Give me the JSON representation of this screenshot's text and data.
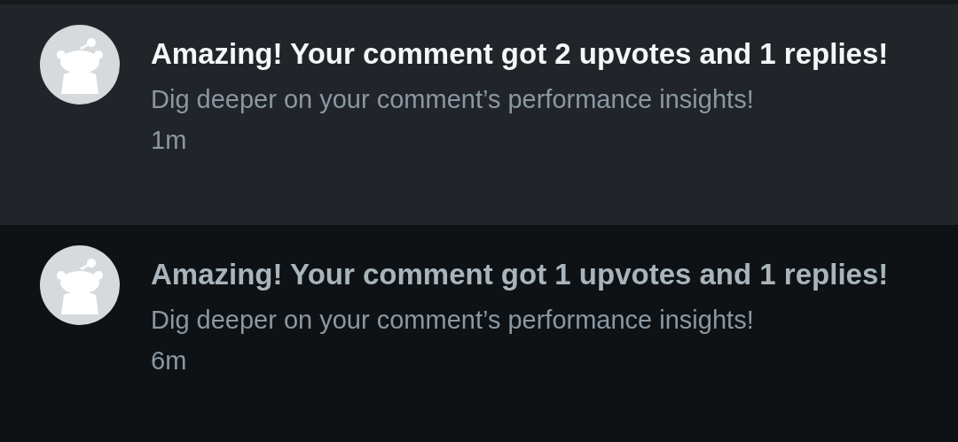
{
  "notifications": [
    {
      "title": "Amazing! Your comment got 2 upvotes and 1 replies!",
      "subtitle": "Dig deeper on your comment’s performance insights!",
      "time": "1m",
      "unread": true
    },
    {
      "title": "Amazing! Your comment got 1 upvotes and 1 replies!",
      "subtitle": "Dig deeper on your comment’s performance insights!",
      "time": "6m",
      "unread": false
    }
  ]
}
